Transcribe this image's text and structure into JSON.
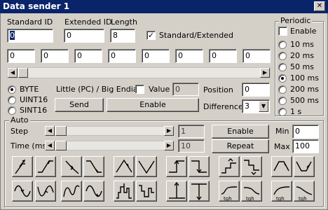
{
  "window": {
    "title": "Data sender 1"
  },
  "ids": {
    "standard_label": "Standard ID",
    "standard_value": "0",
    "extended_label": "Extended ID",
    "extended_value": "0",
    "length_label": "Length",
    "length_value": "8",
    "std_ext_label": "Standard/Extended",
    "std_ext_checked": true
  },
  "data_bytes": [
    "0",
    "0",
    "0",
    "0",
    "0",
    "0",
    "0",
    "0"
  ],
  "periodic": {
    "title": "Periodic",
    "enable_label": "Enable",
    "enable_checked": false,
    "options": [
      "10 ms",
      "20 ms",
      "50 ms",
      "100 ms",
      "200 ms",
      "500 ms",
      "1 s"
    ],
    "selected": "100 ms"
  },
  "format": {
    "types": [
      "BYTE",
      "UINT16",
      "SINT16"
    ],
    "selected": "BYTE",
    "endian_label": "Little (PC) / Big Endian",
    "endian_checked": false,
    "value_label": "Value",
    "value": "0",
    "position_label": "Position",
    "position": "0",
    "difference_label": "Difference",
    "difference": "3",
    "send_label": "Send",
    "enable_label": "Enable"
  },
  "auto": {
    "title": "Auto",
    "step_label": "Step",
    "step_value": "1",
    "time_label": "Time (ms)",
    "time_value": "10",
    "enable_label": "Enable",
    "repeat_label": "Repeat",
    "min_label": "Min",
    "min_value": "0",
    "max_label": "Max",
    "max_value": "100"
  },
  "waveform_tiles": [
    "rise-pulse-icon",
    "rise-step-icon",
    "fall-pulse-icon",
    "fall-step-icon",
    "triangle-up-icon",
    "triangle-down-icon",
    "step-up-icon",
    "step-down-icon",
    "stairs-up-icon",
    "stairs-down-icon",
    "trapezoid-up-icon",
    "trapezoid-down-icon",
    "sine-icon",
    "bump-up-icon",
    "wave-icon",
    "bump-down-icon",
    "block-up-icon",
    "block-down-icon",
    "axis-up-icon",
    "axis-down-icon",
    "tgh-rise-icon",
    "tgh-fall-icon",
    "tgh-rise2-icon",
    "tgh-fall2-icon"
  ],
  "tgh_label": "tgh"
}
